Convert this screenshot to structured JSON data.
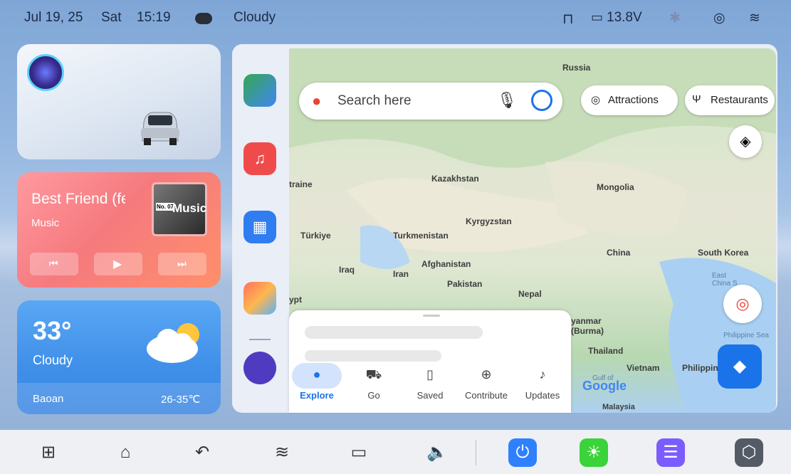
{
  "status": {
    "date": "Jul 19, 25",
    "day": "Sat",
    "time": "15:19",
    "weather": "Cloudy",
    "battery": "13.8V"
  },
  "music": {
    "title": "Best Friend (fe",
    "source": "Music",
    "album_text": "Music",
    "album_tag": "No. 07"
  },
  "weather": {
    "temp": "33°",
    "desc": "Cloudy",
    "city": "Baoan",
    "range": "26-35℃"
  },
  "map": {
    "search_placeholder": "Search here",
    "chips": [
      "Attractions",
      "Restaurants"
    ],
    "labels": {
      "russia": "Russia",
      "kazakhstan": "Kazakhstan",
      "mongolia": "Mongolia",
      "kyrgyzstan": "Kyrgyzstan",
      "turkiye": "Türkiye",
      "turkmenistan": "Turkmenistan",
      "china": "China",
      "south_korea": "South Korea",
      "afghanistan": "Afghanistan",
      "iraq": "Iraq",
      "iran": "Iran",
      "pakistan": "Pakistan",
      "nepal": "Nepal",
      "myanmar": "yanmar\n(Burma)",
      "thailand": "Thailand",
      "vietnam": "Vietnam",
      "philippines": "Philippin",
      "malaysia": "Malaysia",
      "ukraine": "traine",
      "egypt": "ypt",
      "east_china_sea": "East\nChina S",
      "philippine_sea": "Philippine Sea",
      "google": "Google",
      "gulf": "Gulf of"
    },
    "nav": [
      "Explore",
      "Go",
      "Saved",
      "Contribute",
      "Updates"
    ]
  },
  "colors": {
    "accent": "#1a73e8",
    "power": "#2f80ff",
    "brightness": "#3ad33a",
    "storage": "#7b5cff"
  }
}
